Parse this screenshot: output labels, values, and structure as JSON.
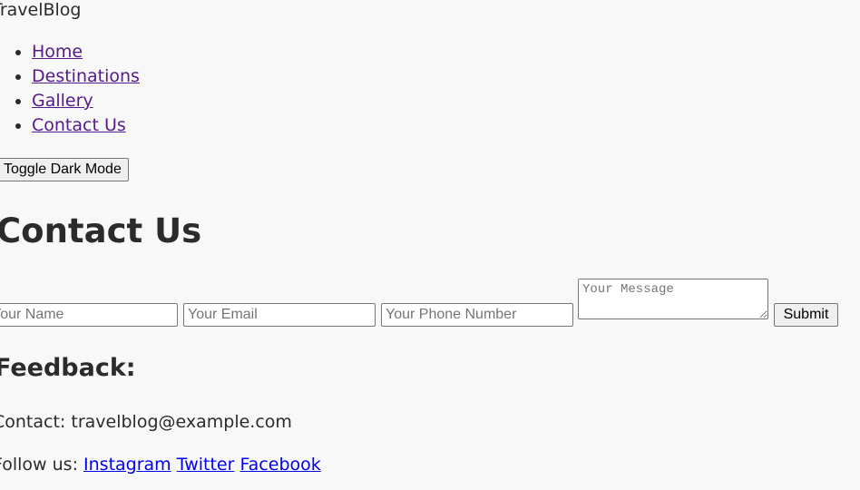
{
  "header": {
    "brand": "TravelBlog",
    "nav": [
      {
        "label": "Home"
      },
      {
        "label": "Destinations"
      },
      {
        "label": "Gallery"
      },
      {
        "label": "Contact Us"
      }
    ],
    "toggle_label": "Toggle Dark Mode"
  },
  "main": {
    "title": "Contact Us",
    "form": {
      "name_placeholder": "Your Name",
      "email_placeholder": "Your Email",
      "phone_placeholder": "Your Phone Number",
      "message_placeholder": "Your Message",
      "submit_label": "Submit"
    },
    "feedback_heading": "Feedback:"
  },
  "footer": {
    "contact": "Contact: travelblog@example.com",
    "follow_prefix": "Follow us:",
    "social": [
      {
        "label": "Instagram"
      },
      {
        "label": "Twitter"
      },
      {
        "label": "Facebook"
      }
    ]
  },
  "colors": {
    "background": "#f8f8f8",
    "text": "#2b2b2b",
    "visited_link": "#551a8b",
    "link": "#0000ee"
  }
}
